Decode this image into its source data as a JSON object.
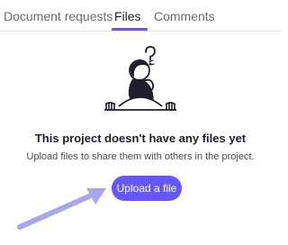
{
  "tabs": [
    {
      "label": "Document requests",
      "active": false
    },
    {
      "label": "Files",
      "active": true
    },
    {
      "label": "Comments",
      "active": false
    }
  ],
  "empty_state": {
    "illustration": "confused-person-peeking-icon",
    "title": "This project doesn't have any files yet",
    "description": "Upload files to share them with others in the project."
  },
  "actions": {
    "upload_label": "Upload a file"
  },
  "annotation": {
    "arrow": "pointing-arrow-icon",
    "color": "#a9a6ee"
  },
  "colors": {
    "accent": "#6656ff",
    "text_primary": "#1f1f2b",
    "text_secondary": "#6b6b78"
  }
}
